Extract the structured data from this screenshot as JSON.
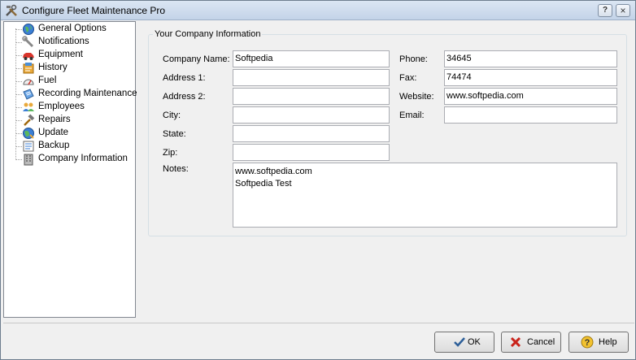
{
  "window": {
    "title": "Configure Fleet Maintenance Pro"
  },
  "tree": {
    "items": [
      {
        "label": "General Options",
        "icon": "globe-icon"
      },
      {
        "label": "Notifications",
        "icon": "wrench-icon"
      },
      {
        "label": "Equipment",
        "icon": "car-icon"
      },
      {
        "label": "History",
        "icon": "history-icon"
      },
      {
        "label": "Fuel",
        "icon": "fuel-gauge-icon"
      },
      {
        "label": "Recording Maintenance",
        "icon": "notebook-icon"
      },
      {
        "label": "Employees",
        "icon": "people-icon"
      },
      {
        "label": "Repairs",
        "icon": "hammer-icon"
      },
      {
        "label": "Update",
        "icon": "globe-update-icon"
      },
      {
        "label": "Backup",
        "icon": "backup-icon"
      },
      {
        "label": "Company Information",
        "icon": "building-icon"
      }
    ]
  },
  "company": {
    "group_title": "Your Company Information",
    "company_name_label": "Company Name:",
    "company_name_value": "Softpedia",
    "address1_label": "Address 1:",
    "address1_value": "",
    "address2_label": "Address 2:",
    "address2_value": "",
    "city_label": "City:",
    "city_value": "",
    "state_label": "State:",
    "state_value": "",
    "zip_label": "Zip:",
    "zip_value": "",
    "phone_label": "Phone:",
    "phone_value": "34645",
    "fax_label": "Fax:",
    "fax_value": "74474",
    "website_label": "Website:",
    "website_value": "www.softpedia.com",
    "email_label": "Email:",
    "email_value": "",
    "notes_label": "Notes:",
    "notes_line1": "www.softpedia.com",
    "notes_line2": "Softpedia Test"
  },
  "buttons": {
    "ok": "OK",
    "cancel": "Cancel",
    "help": "Help"
  }
}
